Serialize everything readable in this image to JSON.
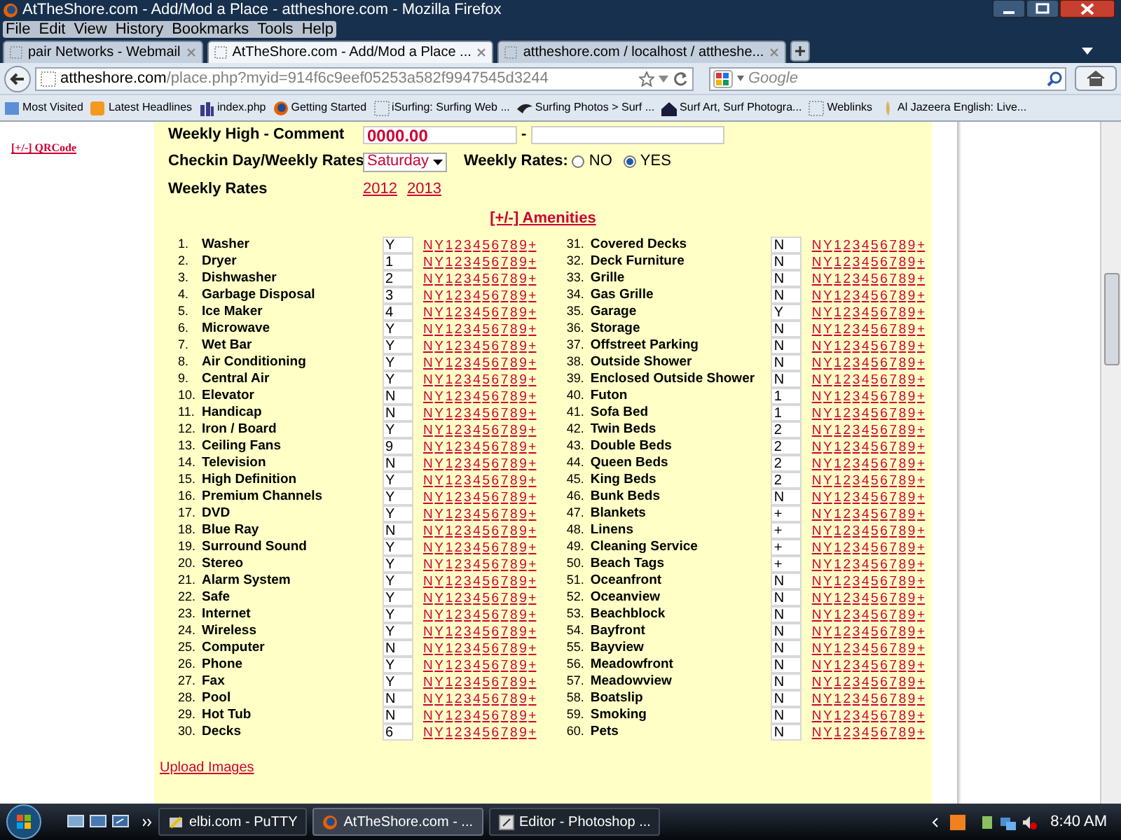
{
  "window": {
    "title": "AtTheShore.com - Add/Mod a Place - attheshore.com - Mozilla Firefox"
  },
  "menu": [
    "File",
    "Edit",
    "View",
    "History",
    "Bookmarks",
    "Tools",
    "Help"
  ],
  "tabs": [
    {
      "label": "pair Networks - Webmail",
      "selected": false
    },
    {
      "label": "AtTheShore.com - Add/Mod a Place ...",
      "selected": true
    },
    {
      "label": "attheshore.com / localhost / attheshe...",
      "selected": false
    }
  ],
  "address": {
    "host": "attheshore.com",
    "path": "/place.php?myid=914f6c9eef05253a582f9947545d3244"
  },
  "search": {
    "placeholder": "Google"
  },
  "bookmarks": [
    "Most Visited",
    "Latest Headlines",
    "index.php",
    "Getting Started",
    "iSurfing: Surfing Web ...",
    "Surfing Photos > Surf ...",
    "Surf Art, Surf Photogra...",
    "Weblinks",
    "Al Jazeera English: Live..."
  ],
  "sidebar": {
    "link": "[+/-] QRCode"
  },
  "form": {
    "weekly_high": {
      "label": "Weekly High - Comment",
      "value": "0000.00",
      "separator": "-"
    },
    "checkin": {
      "label": "Checkin Day/Weekly Rates",
      "value": "Saturday",
      "radio_label": "Weekly Rates:",
      "options": [
        {
          "label": "NO",
          "selected": false
        },
        {
          "label": "YES",
          "selected": true
        }
      ]
    },
    "weekly_rates": {
      "label": "Weekly Rates",
      "links": [
        "2012",
        "2013"
      ]
    },
    "amenities_toggle": "[+/-] Amenities",
    "amenity_columns": [
      {
        "items": [
          {
            "number": "1.",
            "name": "Washer",
            "value": "Y",
            "links": [
              "N",
              "Y",
              "1",
              "2",
              "3",
              "4",
              "5",
              "6",
              "7",
              "8",
              "9",
              "+"
            ]
          },
          {
            "number": "2.",
            "name": "Dryer",
            "value": "1",
            "links": [
              "N",
              "Y",
              "1",
              "2",
              "3",
              "4",
              "5",
              "6",
              "7",
              "8",
              "9",
              "+"
            ]
          },
          {
            "number": "3.",
            "name": "Dishwasher",
            "value": "2",
            "links": [
              "N",
              "Y",
              "1",
              "2",
              "3",
              "4",
              "5",
              "6",
              "7",
              "8",
              "9",
              "+"
            ]
          },
          {
            "number": "4.",
            "name": "Garbage Disposal",
            "value": "3",
            "links": [
              "N",
              "Y",
              "1",
              "2",
              "3",
              "4",
              "5",
              "6",
              "7",
              "8",
              "9",
              "+"
            ]
          },
          {
            "number": "5.",
            "name": "Ice Maker",
            "value": "4",
            "links": [
              "N",
              "Y",
              "1",
              "2",
              "3",
              "4",
              "5",
              "6",
              "7",
              "8",
              "9",
              "+"
            ]
          },
          {
            "number": "6.",
            "name": "Microwave",
            "value": "Y",
            "links": [
              "N",
              "Y",
              "1",
              "2",
              "3",
              "4",
              "5",
              "6",
              "7",
              "8",
              "9",
              "+"
            ]
          },
          {
            "number": "7.",
            "name": "Wet Bar",
            "value": "Y",
            "links": [
              "N",
              "Y",
              "1",
              "2",
              "3",
              "4",
              "5",
              "6",
              "7",
              "8",
              "9",
              "+"
            ]
          },
          {
            "number": "8.",
            "name": "Air Conditioning",
            "value": "Y",
            "links": [
              "N",
              "Y",
              "1",
              "2",
              "3",
              "4",
              "5",
              "6",
              "7",
              "8",
              "9",
              "+"
            ]
          },
          {
            "number": "9.",
            "name": "Central Air",
            "value": "Y",
            "links": [
              "N",
              "Y",
              "1",
              "2",
              "3",
              "4",
              "5",
              "6",
              "7",
              "8",
              "9",
              "+"
            ]
          },
          {
            "number": "10.",
            "name": "Elevator",
            "value": "N",
            "links": [
              "N",
              "Y",
              "1",
              "2",
              "3",
              "4",
              "5",
              "6",
              "7",
              "8",
              "9",
              "+"
            ]
          },
          {
            "number": "11.",
            "name": "Handicap",
            "value": "N",
            "links": [
              "N",
              "Y",
              "1",
              "2",
              "3",
              "4",
              "5",
              "6",
              "7",
              "8",
              "9",
              "+"
            ]
          },
          {
            "number": "12.",
            "name": "Iron / Board",
            "value": "Y",
            "links": [
              "N",
              "Y",
              "1",
              "2",
              "3",
              "4",
              "5",
              "6",
              "7",
              "8",
              "9",
              "+"
            ]
          },
          {
            "number": "13.",
            "name": "Ceiling Fans",
            "value": "9",
            "links": [
              "N",
              "Y",
              "1",
              "2",
              "3",
              "4",
              "5",
              "6",
              "7",
              "8",
              "9",
              "+"
            ]
          },
          {
            "number": "14.",
            "name": "Television",
            "value": "N",
            "links": [
              "N",
              "Y",
              "1",
              "2",
              "3",
              "4",
              "5",
              "6",
              "7",
              "8",
              "9",
              "+"
            ]
          },
          {
            "number": "15.",
            "name": "High Definition",
            "value": "Y",
            "links": [
              "N",
              "Y",
              "1",
              "2",
              "3",
              "4",
              "5",
              "6",
              "7",
              "8",
              "9",
              "+"
            ]
          },
          {
            "number": "16.",
            "name": "Premium Channels",
            "value": "Y",
            "links": [
              "N",
              "Y",
              "1",
              "2",
              "3",
              "4",
              "5",
              "6",
              "7",
              "8",
              "9",
              "+"
            ]
          },
          {
            "number": "17.",
            "name": "DVD",
            "value": "Y",
            "links": [
              "N",
              "Y",
              "1",
              "2",
              "3",
              "4",
              "5",
              "6",
              "7",
              "8",
              "9",
              "+"
            ]
          },
          {
            "number": "18.",
            "name": "Blue Ray",
            "value": "N",
            "links": [
              "N",
              "Y",
              "1",
              "2",
              "3",
              "4",
              "5",
              "6",
              "7",
              "8",
              "9",
              "+"
            ]
          },
          {
            "number": "19.",
            "name": "Surround Sound",
            "value": "Y",
            "links": [
              "N",
              "Y",
              "1",
              "2",
              "3",
              "4",
              "5",
              "6",
              "7",
              "8",
              "9",
              "+"
            ]
          },
          {
            "number": "20.",
            "name": "Stereo",
            "value": "Y",
            "links": [
              "N",
              "Y",
              "1",
              "2",
              "3",
              "4",
              "5",
              "6",
              "7",
              "8",
              "9",
              "+"
            ]
          },
          {
            "number": "21.",
            "name": "Alarm System",
            "value": "Y",
            "links": [
              "N",
              "Y",
              "1",
              "2",
              "3",
              "4",
              "5",
              "6",
              "7",
              "8",
              "9",
              "+"
            ]
          },
          {
            "number": "22.",
            "name": "Safe",
            "value": "Y",
            "links": [
              "N",
              "Y",
              "1",
              "2",
              "3",
              "4",
              "5",
              "6",
              "7",
              "8",
              "9",
              "+"
            ]
          },
          {
            "number": "23.",
            "name": "Internet",
            "value": "Y",
            "links": [
              "N",
              "Y",
              "1",
              "2",
              "3",
              "4",
              "5",
              "6",
              "7",
              "8",
              "9",
              "+"
            ]
          },
          {
            "number": "24.",
            "name": "Wireless",
            "value": "Y",
            "links": [
              "N",
              "Y",
              "1",
              "2",
              "3",
              "4",
              "5",
              "6",
              "7",
              "8",
              "9",
              "+"
            ]
          },
          {
            "number": "25.",
            "name": "Computer",
            "value": "N",
            "links": [
              "N",
              "Y",
              "1",
              "2",
              "3",
              "4",
              "5",
              "6",
              "7",
              "8",
              "9",
              "+"
            ]
          },
          {
            "number": "26.",
            "name": "Phone",
            "value": "Y",
            "links": [
              "N",
              "Y",
              "1",
              "2",
              "3",
              "4",
              "5",
              "6",
              "7",
              "8",
              "9",
              "+"
            ]
          },
          {
            "number": "27.",
            "name": "Fax",
            "value": "Y",
            "links": [
              "N",
              "Y",
              "1",
              "2",
              "3",
              "4",
              "5",
              "6",
              "7",
              "8",
              "9",
              "+"
            ]
          },
          {
            "number": "28.",
            "name": "Pool",
            "value": "N",
            "links": [
              "N",
              "Y",
              "1",
              "2",
              "3",
              "4",
              "5",
              "6",
              "7",
              "8",
              "9",
              "+"
            ]
          },
          {
            "number": "29.",
            "name": "Hot Tub",
            "value": "N",
            "links": [
              "N",
              "Y",
              "1",
              "2",
              "3",
              "4",
              "5",
              "6",
              "7",
              "8",
              "9",
              "+"
            ]
          },
          {
            "number": "30.",
            "name": "Decks",
            "value": "6",
            "links": [
              "N",
              "Y",
              "1",
              "2",
              "3",
              "4",
              "5",
              "6",
              "7",
              "8",
              "9",
              "+"
            ]
          }
        ]
      },
      {
        "items": [
          {
            "number": "31.",
            "name": "Covered Decks",
            "value": "N",
            "links": [
              "N",
              "Y",
              "1",
              "2",
              "3",
              "4",
              "5",
              "6",
              "7",
              "8",
              "9",
              "+"
            ]
          },
          {
            "number": "32.",
            "name": "Deck Furniture",
            "value": "N",
            "links": [
              "N",
              "Y",
              "1",
              "2",
              "3",
              "4",
              "5",
              "6",
              "7",
              "8",
              "9",
              "+"
            ]
          },
          {
            "number": "33.",
            "name": "Grille",
            "value": "N",
            "links": [
              "N",
              "Y",
              "1",
              "2",
              "3",
              "4",
              "5",
              "6",
              "7",
              "8",
              "9",
              "+"
            ]
          },
          {
            "number": "34.",
            "name": "Gas Grille",
            "value": "N",
            "links": [
              "N",
              "Y",
              "1",
              "2",
              "3",
              "4",
              "5",
              "6",
              "7",
              "8",
              "9",
              "+"
            ]
          },
          {
            "number": "35.",
            "name": "Garage",
            "value": "Y",
            "links": [
              "N",
              "Y",
              "1",
              "2",
              "3",
              "4",
              "5",
              "6",
              "7",
              "8",
              "9",
              "+"
            ]
          },
          {
            "number": "36.",
            "name": "Storage",
            "value": "N",
            "links": [
              "N",
              "Y",
              "1",
              "2",
              "3",
              "4",
              "5",
              "6",
              "7",
              "8",
              "9",
              "+"
            ]
          },
          {
            "number": "37.",
            "name": "Offstreet Parking",
            "value": "N",
            "links": [
              "N",
              "Y",
              "1",
              "2",
              "3",
              "4",
              "5",
              "6",
              "7",
              "8",
              "9",
              "+"
            ]
          },
          {
            "number": "38.",
            "name": "Outside Shower",
            "value": "N",
            "links": [
              "N",
              "Y",
              "1",
              "2",
              "3",
              "4",
              "5",
              "6",
              "7",
              "8",
              "9",
              "+"
            ]
          },
          {
            "number": "39.",
            "name": "Enclosed Outside Shower",
            "value": "N",
            "links": [
              "N",
              "Y",
              "1",
              "2",
              "3",
              "4",
              "5",
              "6",
              "7",
              "8",
              "9",
              "+"
            ]
          },
          {
            "number": "40.",
            "name": "Futon",
            "value": "1",
            "links": [
              "N",
              "Y",
              "1",
              "2",
              "3",
              "4",
              "5",
              "6",
              "7",
              "8",
              "9",
              "+"
            ]
          },
          {
            "number": "41.",
            "name": "Sofa Bed",
            "value": "1",
            "links": [
              "N",
              "Y",
              "1",
              "2",
              "3",
              "4",
              "5",
              "6",
              "7",
              "8",
              "9",
              "+"
            ]
          },
          {
            "number": "42.",
            "name": "Twin Beds",
            "value": "2",
            "links": [
              "N",
              "Y",
              "1",
              "2",
              "3",
              "4",
              "5",
              "6",
              "7",
              "8",
              "9",
              "+"
            ]
          },
          {
            "number": "43.",
            "name": "Double Beds",
            "value": "2",
            "links": [
              "N",
              "Y",
              "1",
              "2",
              "3",
              "4",
              "5",
              "6",
              "7",
              "8",
              "9",
              "+"
            ]
          },
          {
            "number": "44.",
            "name": "Queen Beds",
            "value": "2",
            "links": [
              "N",
              "Y",
              "1",
              "2",
              "3",
              "4",
              "5",
              "6",
              "7",
              "8",
              "9",
              "+"
            ]
          },
          {
            "number": "45.",
            "name": "King Beds",
            "value": "2",
            "links": [
              "N",
              "Y",
              "1",
              "2",
              "3",
              "4",
              "5",
              "6",
              "7",
              "8",
              "9",
              "+"
            ]
          },
          {
            "number": "46.",
            "name": "Bunk Beds",
            "value": "N",
            "links": [
              "N",
              "Y",
              "1",
              "2",
              "3",
              "4",
              "5",
              "6",
              "7",
              "8",
              "9",
              "+"
            ]
          },
          {
            "number": "47.",
            "name": "Blankets",
            "value": "+",
            "links": [
              "N",
              "Y",
              "1",
              "2",
              "3",
              "4",
              "5",
              "6",
              "7",
              "8",
              "9",
              "+"
            ]
          },
          {
            "number": "48.",
            "name": "Linens",
            "value": "+",
            "links": [
              "N",
              "Y",
              "1",
              "2",
              "3",
              "4",
              "5",
              "6",
              "7",
              "8",
              "9",
              "+"
            ]
          },
          {
            "number": "49.",
            "name": "Cleaning Service",
            "value": "+",
            "links": [
              "N",
              "Y",
              "1",
              "2",
              "3",
              "4",
              "5",
              "6",
              "7",
              "8",
              "9",
              "+"
            ]
          },
          {
            "number": "50.",
            "name": "Beach Tags",
            "value": "+",
            "links": [
              "N",
              "Y",
              "1",
              "2",
              "3",
              "4",
              "5",
              "6",
              "7",
              "8",
              "9",
              "+"
            ]
          },
          {
            "number": "51.",
            "name": "Oceanfront",
            "value": "N",
            "links": [
              "N",
              "Y",
              "1",
              "2",
              "3",
              "4",
              "5",
              "6",
              "7",
              "8",
              "9",
              "+"
            ]
          },
          {
            "number": "52.",
            "name": "Oceanview",
            "value": "N",
            "links": [
              "N",
              "Y",
              "1",
              "2",
              "3",
              "4",
              "5",
              "6",
              "7",
              "8",
              "9",
              "+"
            ]
          },
          {
            "number": "53.",
            "name": "Beachblock",
            "value": "N",
            "links": [
              "N",
              "Y",
              "1",
              "2",
              "3",
              "4",
              "5",
              "6",
              "7",
              "8",
              "9",
              "+"
            ]
          },
          {
            "number": "54.",
            "name": "Bayfront",
            "value": "N",
            "links": [
              "N",
              "Y",
              "1",
              "2",
              "3",
              "4",
              "5",
              "6",
              "7",
              "8",
              "9",
              "+"
            ]
          },
          {
            "number": "55.",
            "name": "Bayview",
            "value": "N",
            "links": [
              "N",
              "Y",
              "1",
              "2",
              "3",
              "4",
              "5",
              "6",
              "7",
              "8",
              "9",
              "+"
            ]
          },
          {
            "number": "56.",
            "name": "Meadowfront",
            "value": "N",
            "links": [
              "N",
              "Y",
              "1",
              "2",
              "3",
              "4",
              "5",
              "6",
              "7",
              "8",
              "9",
              "+"
            ]
          },
          {
            "number": "57.",
            "name": "Meadowview",
            "value": "N",
            "links": [
              "N",
              "Y",
              "1",
              "2",
              "3",
              "4",
              "5",
              "6",
              "7",
              "8",
              "9",
              "+"
            ]
          },
          {
            "number": "58.",
            "name": "Boatslip",
            "value": "N",
            "links": [
              "N",
              "Y",
              "1",
              "2",
              "3",
              "4",
              "5",
              "6",
              "7",
              "8",
              "9",
              "+"
            ]
          },
          {
            "number": "59.",
            "name": "Smoking",
            "value": "N",
            "links": [
              "N",
              "Y",
              "1",
              "2",
              "3",
              "4",
              "5",
              "6",
              "7",
              "8",
              "9",
              "+"
            ]
          },
          {
            "number": "60.",
            "name": "Pets",
            "value": "N",
            "links": [
              "N",
              "Y",
              "1",
              "2",
              "3",
              "4",
              "5",
              "6",
              "7",
              "8",
              "9",
              "+"
            ]
          }
        ]
      }
    ],
    "upload_link": "Upload Images"
  },
  "taskbar": {
    "tasks": [
      {
        "label": "elbi.com - PuTTY",
        "selected": false
      },
      {
        "label": "AtTheShore.com - ...",
        "selected": true
      },
      {
        "label": "Editor - Photoshop ...",
        "selected": false
      }
    ],
    "clock": "8:40 AM"
  }
}
